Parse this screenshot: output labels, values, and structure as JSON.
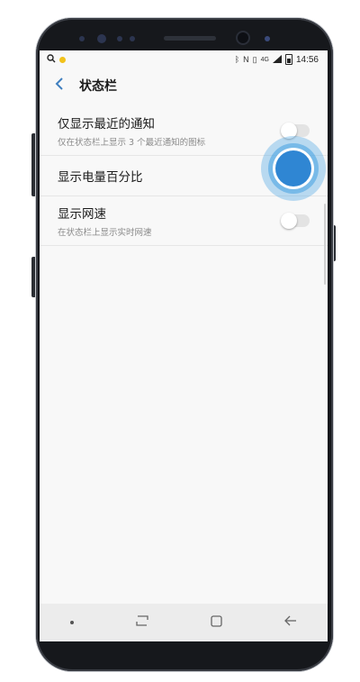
{
  "status_bar": {
    "left_icons": [
      "search-icon",
      "notification-dot-icon"
    ],
    "right_icons": [
      "bluetooth-icon",
      "nfc-icon",
      "vibrate-icon",
      "4g-icon",
      "signal-icon",
      "battery-icon"
    ],
    "time": "14:56",
    "network_label": "4G"
  },
  "app_bar": {
    "back_icon": "chevron-left-icon",
    "title": "状态栏"
  },
  "settings": [
    {
      "title": "仅显示最近的通知",
      "subtitle": "仅在状态栏上显示 3 个最近通知的图标",
      "toggle": false
    },
    {
      "title": "显示电量百分比",
      "subtitle": "",
      "toggle": true
    },
    {
      "title": "显示网速",
      "subtitle": "在状态栏上显示实时网速",
      "toggle": false
    }
  ],
  "nav_bar": {
    "items": [
      "dot-icon",
      "recents-icon",
      "home-icon",
      "back-icon"
    ]
  },
  "colors": {
    "accent": "#3f7fbf",
    "touch": "#2f86d3",
    "notification_dot": "#f2c21b"
  }
}
